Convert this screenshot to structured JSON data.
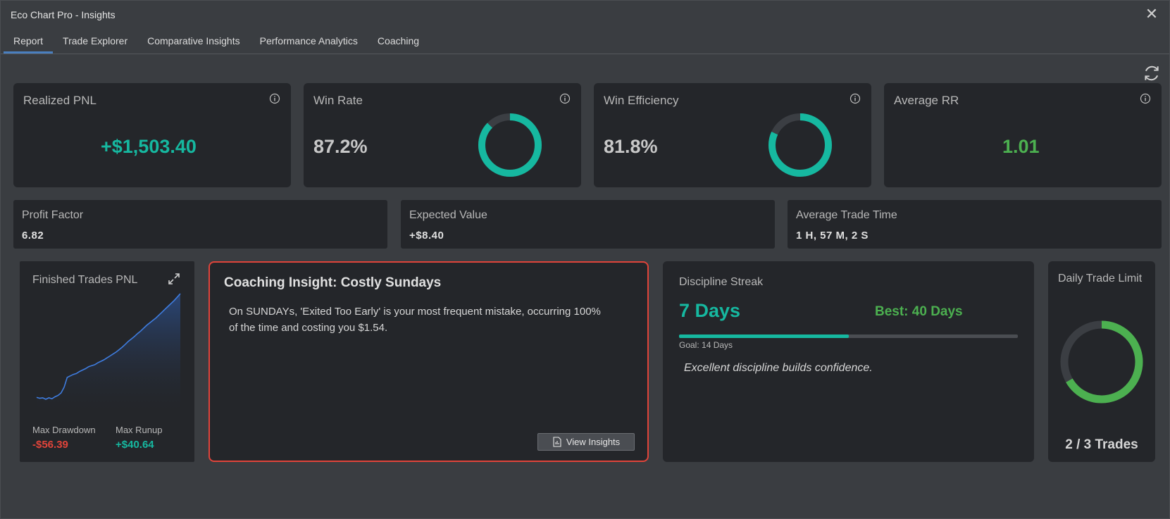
{
  "window": {
    "title": "Eco Chart Pro - Insights"
  },
  "tabs": [
    {
      "label": "Report"
    },
    {
      "label": "Trade Explorer"
    },
    {
      "label": "Comparative Insights"
    },
    {
      "label": "Performance Analytics"
    },
    {
      "label": "Coaching"
    }
  ],
  "kpis": {
    "realized_pnl": {
      "title": "Realized PNL",
      "value": "+$1,503.40"
    },
    "win_rate": {
      "title": "Win Rate",
      "value": "87.2%",
      "fraction": 0.872
    },
    "win_efficiency": {
      "title": "Win Efficiency",
      "value": "81.8%",
      "fraction": 0.818
    },
    "average_rr": {
      "title": "Average RR",
      "value": "1.01"
    }
  },
  "stats": {
    "profit_factor": {
      "title": "Profit Factor",
      "value": "6.82"
    },
    "expected_value": {
      "title": "Expected Value",
      "value": "+$8.40"
    },
    "avg_trade_time": {
      "title": "Average Trade Time",
      "value": "1 H, 57 M, 2 S"
    }
  },
  "pnl_chart": {
    "title": "Finished Trades PNL",
    "max_drawdown_label": "Max Drawdown",
    "max_drawdown_value": "-$56.39",
    "max_runup_label": "Max Runup",
    "max_runup_value": "+$40.64"
  },
  "chart_data": {
    "type": "area",
    "title": "Finished Trades PNL",
    "values": [
      -1,
      -3,
      -2,
      -5,
      -2,
      -4,
      0,
      3,
      8,
      20,
      40,
      43,
      46,
      48,
      52,
      55,
      58,
      62,
      64,
      66,
      70,
      73,
      76,
      80,
      84,
      88,
      92,
      97,
      102,
      108,
      114,
      119,
      124,
      130,
      135,
      141,
      147,
      152,
      157,
      162,
      168,
      174,
      180,
      186,
      192,
      198,
      205,
      212
    ]
  },
  "coaching": {
    "title": "Coaching Insight: Costly Sundays",
    "body": "On SUNDAYs, 'Exited Too Early' is your most frequent mistake, occurring 100% of the time and costing you $1.54.",
    "button": "View Insights"
  },
  "discipline": {
    "title": "Discipline Streak",
    "current": "7 Days",
    "best": "Best: 40 Days",
    "progress_fraction": 0.5,
    "goal": "Goal: 14 Days",
    "message": "Excellent discipline builds confidence."
  },
  "daily_limit": {
    "title": "Daily Trade Limit",
    "value": "2 / 3 Trades",
    "fraction": 0.667
  },
  "colors": {
    "accent_teal": "#16b8a0",
    "accent_green": "#4cb050",
    "accent_red": "#e0443a",
    "tab_active": "#4a7fbf"
  }
}
